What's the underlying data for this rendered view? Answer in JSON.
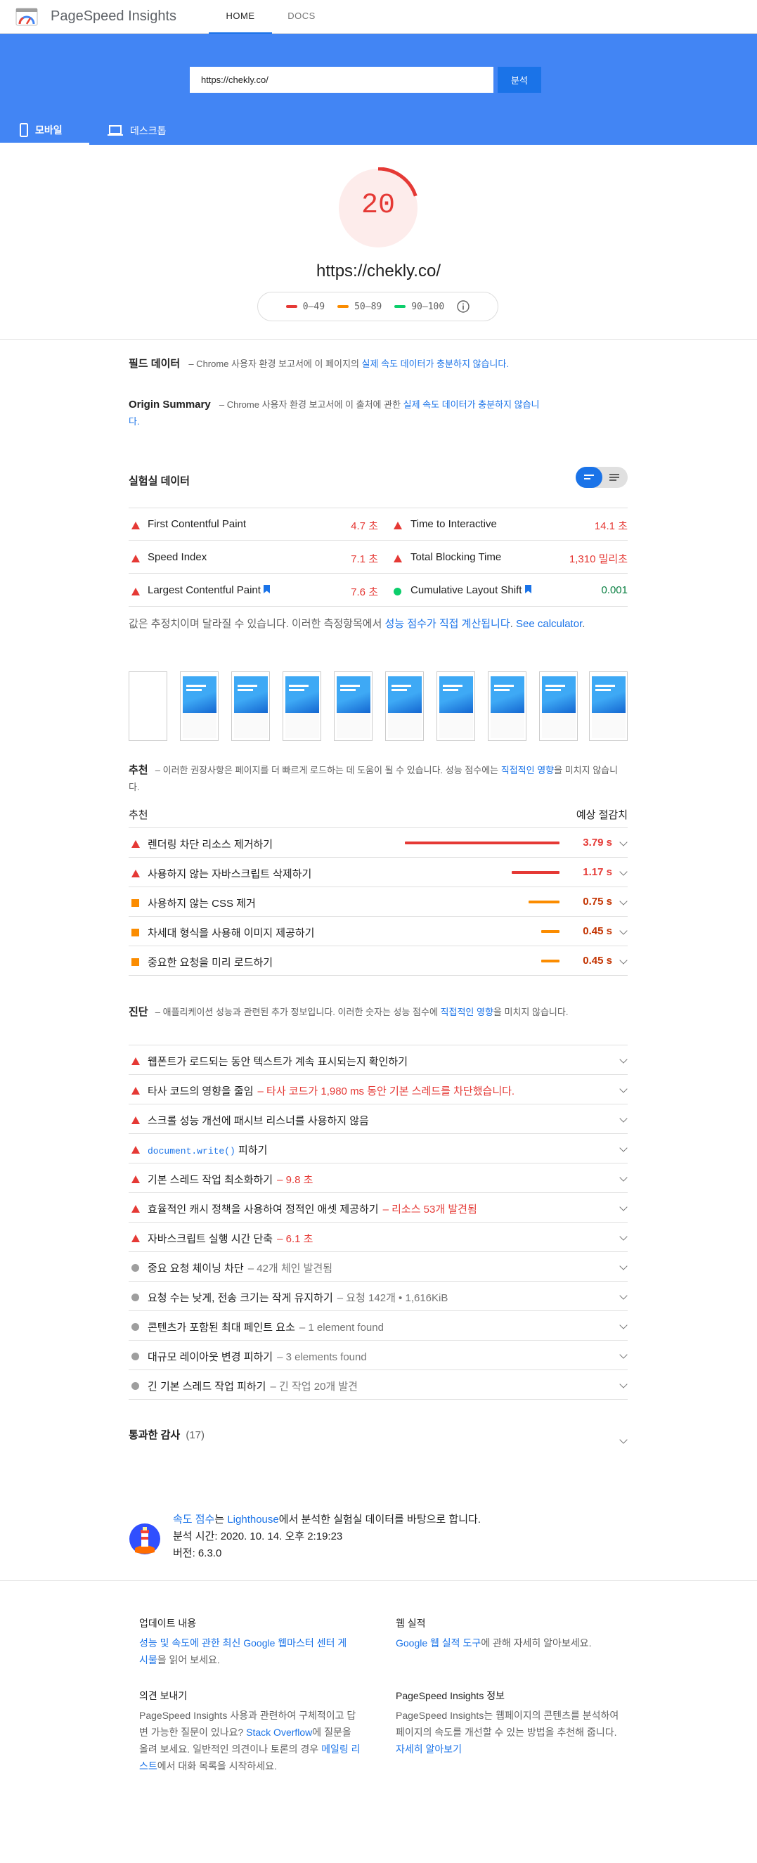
{
  "header": {
    "app_name": "PageSpeed Insights",
    "tabs": [
      "HOME",
      "DOCS"
    ]
  },
  "search": {
    "url_value": "https://chekly.co/",
    "analyze_label": "분석"
  },
  "device_tabs": [
    "모바일",
    "데스크톱"
  ],
  "score": {
    "value": "20",
    "value_fraction": 0.2,
    "tested_url": "https://chekly.co/",
    "legend": [
      "0–49",
      "50–89",
      "90–100"
    ]
  },
  "colors": {
    "fail": "#e53935",
    "average": "#fb8c00",
    "pass": "#0cce6b",
    "accent": "#1a73e8",
    "band": "#4285f4"
  },
  "field_data": {
    "title": "필드 데이터",
    "desc_pre": "– Chrome 사용자 환경 보고서에 이 페이지의 ",
    "desc_link": "실제 속도 데이터가 충분하지 않습니다."
  },
  "origin_summary": {
    "title": "Origin Summary",
    "desc_pre": "– Chrome 사용자 환경 보고서에 이 출처에 관한 ",
    "desc_link": "실제 속도 데이터가 충분하지 않습니",
    "desc_end": "다."
  },
  "lab": {
    "title": "실험실 데이터",
    "metrics": [
      {
        "name": "First Contentful Paint",
        "value": "4.7 초",
        "status": "fail"
      },
      {
        "name": "Time to Interactive",
        "value": "14.1 초",
        "status": "fail"
      },
      {
        "name": "Speed Index",
        "value": "7.1 초",
        "status": "fail"
      },
      {
        "name": "Total Blocking Time",
        "value": "1,310 밀리초",
        "status": "fail"
      },
      {
        "name": "Largest Contentful Paint",
        "value": "7.6 초",
        "status": "fail"
      },
      {
        "name": "Cumulative Layout Shift",
        "value": "0.001",
        "status": "pass"
      }
    ],
    "note_pre": "값은 추정치이며 달라질 수 있습니다. 이러한 측정항목에서 ",
    "note_link1": "성능 점수가 직접 계산됩니다",
    "note_mid": ". ",
    "note_link2": "See calculator",
    "note_end": "."
  },
  "opportunities": {
    "title": "추천",
    "desc_pre": "– 이러한 권장사항은 페이지를 더 빠르게 로드하는 데 도움이 될 수 있습니다. 성능 점수에는 ",
    "desc_link": "직접적인 영향",
    "desc_end": "을 미치지 않습니다.",
    "col_left": "추천",
    "col_right": "예상 절감치",
    "items": [
      {
        "name": "렌더링 차단 리소스 제거하기",
        "savings": "3.79 s",
        "seconds": 3.79,
        "status": "fail"
      },
      {
        "name": "사용하지 않는 자바스크립트 삭제하기",
        "savings": "1.17 s",
        "seconds": 1.17,
        "status": "fail"
      },
      {
        "name": "사용하지 않는 CSS 제거",
        "savings": "0.75 s",
        "seconds": 0.75,
        "status": "average"
      },
      {
        "name": "차세대 형식을 사용해 이미지 제공하기",
        "savings": "0.45 s",
        "seconds": 0.45,
        "status": "average"
      },
      {
        "name": "중요한 요청을 미리 로드하기",
        "savings": "0.45 s",
        "seconds": 0.45,
        "status": "average"
      }
    ]
  },
  "diagnostics": {
    "title": "진단",
    "desc_pre": "– 애플리케이션 성능과 관련된 추가 정보입니다. 이러한 숫자는 성능 점수에 ",
    "desc_link": "직접적인 영향",
    "desc_end": "을 미치지 않습니다.",
    "items": [
      {
        "name": "웹폰트가 로드되는 동안 텍스트가 계속 표시되는지 확인하기",
        "sub": "",
        "status": "fail"
      },
      {
        "name": "타사 코드의 영향을 줄임",
        "sub": "– 타사 코드가 1,980 ms 동안 기본 스레드를 차단했습니다.",
        "status": "fail"
      },
      {
        "name": "스크롤 성능 개선에 패시브 리스너를 사용하지 않음",
        "sub": "",
        "status": "fail"
      },
      {
        "name_code": "document.write()",
        "name": " 피하기",
        "sub": "",
        "status": "fail"
      },
      {
        "name": "기본 스레드 작업 최소화하기",
        "sub": "– 9.8 초",
        "status": "fail"
      },
      {
        "name": "효율적인 캐시 정책을 사용하여 정적인 애셋 제공하기",
        "sub": "– 리소스 53개 발견됨",
        "status": "fail"
      },
      {
        "name": "자바스크립트 실행 시간 단축",
        "sub": "– 6.1 초",
        "status": "fail"
      },
      {
        "name": "중요 요청 체이닝 차단",
        "sub": "– 42개 체인 발견됨",
        "status": "info"
      },
      {
        "name": "요청 수는 낮게, 전송 크기는 작게 유지하기",
        "sub": "– 요청 142개 • 1,616KiB",
        "status": "info"
      },
      {
        "name": "콘텐츠가 포함된 최대 페인트 요소",
        "sub": "– 1 element found",
        "status": "info"
      },
      {
        "name": "대규모 레이아웃 변경 피하기",
        "sub": "– 3 elements found",
        "status": "info"
      },
      {
        "name": "긴 기본 스레드 작업 피하기",
        "sub": "– 긴 작업 20개 발견",
        "status": "info"
      }
    ]
  },
  "passed": {
    "title": "통과한 감사",
    "count": "(17)"
  },
  "runtime": {
    "line1_link1": "속도 점수",
    "line1_mid": "는 ",
    "line1_link2": "Lighthouse",
    "line1_end": "에서 분석한 실험실 데이터를 바탕으로 합니다.",
    "line2": "분석 시간: 2020. 10. 14. 오후 2:19:23",
    "line3": "버전: 6.3.0"
  },
  "footer": {
    "updates_title": "업데이트 내용",
    "updates_link": "성능 및 속도에 관한 최신 Google 웹마스터 센터 게시물",
    "updates_end": "을 읽어 보세요.",
    "web_title": "웹 실적",
    "web_link": "Google 웹 실적 도구",
    "web_end": "에 관해 자세히 알아보세요.",
    "feedback_title": "의견 보내기",
    "feedback_pre": "PageSpeed Insights 사용과 관련하여 구체적이고 답변 가능한 질문이 있나요? ",
    "feedback_link1": "Stack Overflow",
    "feedback_mid": "에 질문을 올려 보세요. 일반적인 의견이나 토론의 경우 ",
    "feedback_link2": "메일링 리스트",
    "feedback_end": "에서 대화 목록을 시작하세요.",
    "about_title": "PageSpeed Insights 정보",
    "about_pre": "PageSpeed Insights는 웹페이지의 콘텐츠를 분석하여 페이지의 속도를 개선할 수 있는 방법을 추천해 줍니다. ",
    "about_link": "자세히 알아보기"
  }
}
